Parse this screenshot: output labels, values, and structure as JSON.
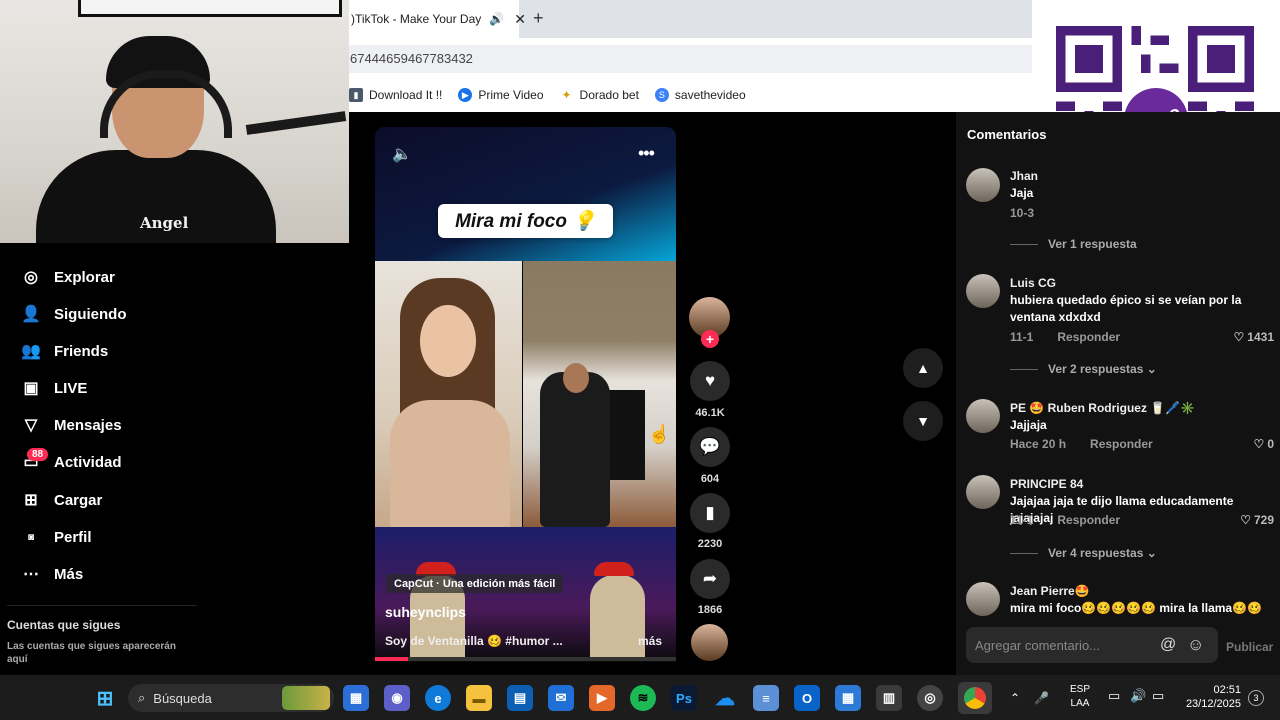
{
  "browser": {
    "tab_title": ")TikTok - Make Your Day",
    "url": "67444659467783432",
    "bookmarks": [
      {
        "label": "Download It !!",
        "icon": "bookmark-icon"
      },
      {
        "label": "Prime Video",
        "icon": "play-icon"
      },
      {
        "label": "Dorado bet",
        "icon": "star-icon"
      },
      {
        "label": "savethevideo",
        "icon": "s-icon"
      }
    ]
  },
  "webcam": {
    "shirt_text": "Angel"
  },
  "qr": {
    "brand": "yape"
  },
  "sidebar": {
    "items": [
      {
        "label": "Explorar",
        "icon": "compass-icon"
      },
      {
        "label": "Siguiendo",
        "icon": "user-follow-icon"
      },
      {
        "label": "Friends",
        "icon": "friends-icon"
      },
      {
        "label": "LIVE",
        "icon": "live-icon"
      },
      {
        "label": "Mensajes",
        "icon": "send-icon"
      },
      {
        "label": "Actividad",
        "icon": "inbox-icon"
      },
      {
        "label": "Cargar",
        "icon": "upload-icon"
      },
      {
        "label": "Perfil",
        "icon": "profile-icon"
      },
      {
        "label": "Más",
        "icon": "more-icon"
      }
    ],
    "activity_badge": "88",
    "following_title": "Cuentas que sigues",
    "following_sub": "Las cuentas que sigues aparecerán aquí"
  },
  "video": {
    "caption": "Mira mi foco 💡",
    "capcut": "CapCut · Una edición más fácil",
    "author": "suheynclips",
    "description": "Soy de Ventanilla 🥴 #humor ...",
    "more": "más",
    "progress": 0.11
  },
  "actions": {
    "likes": "46.1K",
    "comments": "604",
    "saves": "2230",
    "shares": "1866"
  },
  "comments": {
    "title": "Comentarios",
    "items": [
      {
        "user": "Jhan",
        "text": "Jaja",
        "date": "10-3",
        "reply": "",
        "likes": ""
      },
      {
        "user": "Luis CG",
        "text": "hubiera quedado épico si se veían por la ventana xdxdxd",
        "date": "11-1",
        "reply": "Responder",
        "likes": "1431",
        "more": "Ver 2 respuestas"
      },
      {
        "user": "PE 🤩 Ruben Rodriguez 🥛🖊️✳️",
        "text": "Jajjaja",
        "date": "Hace 20 h",
        "reply": "Responder",
        "likes": "0"
      },
      {
        "user": "PRINCIPE 84",
        "text": "Jajajaa jaja te dijo llama educadamente jajajajaj",
        "date": "11-1",
        "reply": "Responder",
        "likes": "729",
        "more": "Ver 4 respuestas"
      },
      {
        "user": "Jean Pierre🤩",
        "text": "mira mi foco🥴🥴🥴🥴🥴 mira la llama🥴🥴",
        "date": "",
        "reply": "",
        "likes": ""
      }
    ],
    "more_top": "Ver 1 respuesta",
    "input_placeholder": "Agregar comentario...",
    "publish": "Publicar"
  },
  "taskbar": {
    "search": "Búsqueda",
    "lang_top": "ESP",
    "lang_bottom": "LAA",
    "time": "02:51",
    "date": "23/12/2025",
    "notifications": "3"
  }
}
